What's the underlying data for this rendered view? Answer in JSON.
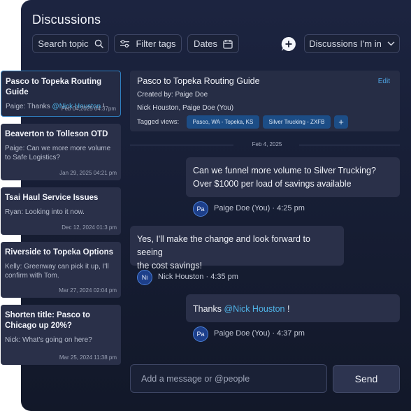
{
  "header": {
    "title": "Discussions",
    "search_label": "Search topic",
    "filter_label": "Filter tags",
    "dates_label": "Dates",
    "scope_label": "Discussions I'm in"
  },
  "threads": [
    {
      "title": "Pasco to Topeka Routing Guide",
      "author": "Paige:",
      "pre": "Thanks ",
      "mention": "@Nick Houston",
      "post": " !",
      "date": "Feb 04,2025 04:37pm"
    },
    {
      "title": "Beaverton to Tolleson OTD",
      "snippet": "Paige: Can we more more volume to Safe Logistics?",
      "date": "Jan 29, 2025 04:21 pm"
    },
    {
      "title": "Tsai Haul Service Issues",
      "snippet": "Ryan: Looking into it now.",
      "date": "Dec 12, 2024 01:3 pm"
    },
    {
      "title": "Riverside to Topeka Options",
      "snippet": "Kelly: Greenway can pick it up, I'll confirm with Tom.",
      "date": "Mar 27, 2024 02:04 pm"
    },
    {
      "title": "Shorten title: Pasco to Chicago up 20%?",
      "snippet": "Nick: What's going on here?",
      "date": "Mar 25, 2024 11:38 pm"
    }
  ],
  "discussion": {
    "title": "Pasco to Topeka Routing Guide",
    "edit_label": "Edit",
    "created_by": "Created by: Paige Doe",
    "members": "Nick Houston, Paige Doe (You)",
    "tagged_label": "Tagged views:",
    "tags": [
      "Pasco, WA - Topeka, KS",
      "Silver Trucking - ZXFB"
    ],
    "add_tag_label": "+",
    "date_divider": "Feb 4, 2025"
  },
  "messages": [
    {
      "lines": [
        "Can we funnel more volume to Silver Trucking?",
        "Over $1000 per load of savings available"
      ],
      "initials": "Pa",
      "author": "Paige Doe (You)",
      "time": "· 4:25 pm"
    },
    {
      "lines": [
        "Yes, I'll make the change and look forward to seeing",
        "the cost savings!"
      ],
      "initials": "Ni",
      "author": "Nick Houston",
      "time": "· 4:35 pm"
    },
    {
      "pre": "Thanks ",
      "mention": "@Nick Houston",
      "post": " !",
      "initials": "Pa",
      "author": "Paige Doe (You)",
      "time": "· 4:37 pm"
    }
  ],
  "composer": {
    "placeholder": "Add a message or @people",
    "send_label": "Send"
  },
  "icons": {
    "search": "search-icon",
    "filter": "filter-icon",
    "calendar": "calendar-icon",
    "new_discussion": "add-comment-icon",
    "dropdown": "chevron-down-icon"
  },
  "colors": {
    "accent": "#4fb4e8",
    "tag_bg": "#1c4d86",
    "active_border": "#2f7fc0"
  }
}
